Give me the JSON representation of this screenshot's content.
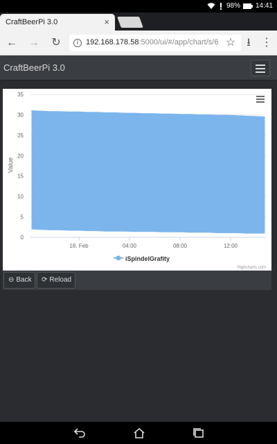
{
  "status_bar": {
    "battery": "98%",
    "time": "14:41"
  },
  "browser": {
    "tab_title": "CraftBeerPi 3.0",
    "url_host": "192.168.178.58",
    "url_path": ":5000/ui/#/app/chart/s/6"
  },
  "app": {
    "brand": "CraftBeerPi 3.0"
  },
  "chart": {
    "y_ticks": [
      "35",
      "30",
      "25",
      "20",
      "15",
      "10",
      "5",
      "0"
    ],
    "x_ticks": [
      "18. Feb",
      "04:00",
      "08:00",
      "12:00"
    ],
    "credits": "Highcharts.com"
  },
  "chart_data": {
    "type": "area",
    "ylabel": "Value",
    "ylim": [
      0,
      35
    ],
    "x_ticks": [
      "18. Feb",
      "04:00",
      "08:00",
      "12:00"
    ],
    "series": [
      {
        "name": "iSpindelGrafity",
        "color": "#7cb5ec",
        "x_hours_from_start": [
          0,
          1,
          2,
          3,
          4,
          5,
          6,
          7,
          8,
          9,
          10,
          11,
          12,
          13,
          14,
          15,
          16,
          17,
          18,
          19,
          20,
          21,
          22,
          23,
          24,
          25
        ],
        "low": [
          2.0,
          1.9,
          1.8,
          1.8,
          1.7,
          1.7,
          1.6,
          1.6,
          1.5,
          1.5,
          1.5,
          1.4,
          1.4,
          1.4,
          1.3,
          1.3,
          1.3,
          1.2,
          1.2,
          1.2,
          1.1,
          1.1,
          1.1,
          1.0,
          1.0,
          1.0
        ],
        "high": [
          31.0,
          30.9,
          30.8,
          30.8,
          30.7,
          30.7,
          30.6,
          30.6,
          30.5,
          30.5,
          30.4,
          30.4,
          30.3,
          30.3,
          30.2,
          30.2,
          30.1,
          30.1,
          30.0,
          30.0,
          29.9,
          29.9,
          29.8,
          29.7,
          29.6,
          29.5
        ]
      }
    ],
    "legend": [
      "iSpindelGrafity"
    ],
    "grid": true
  },
  "buttons": {
    "back": "Back",
    "reload": "Reload"
  }
}
